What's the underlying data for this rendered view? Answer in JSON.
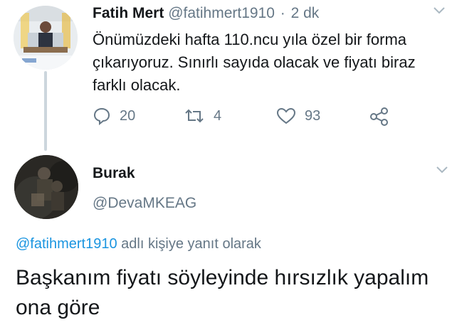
{
  "tweet1": {
    "name": "Fatih Mert",
    "handle": "@fatihmert1910",
    "separator": "·",
    "time": "2 dk",
    "text": "Önümüzdeki hafta 110.ncu yıla özel bir forma çıkarıyoruz. Sınırlı sayıda olacak ve fiyatı biraz farklı olacak.",
    "replies": "20",
    "retweets": "4",
    "likes": "93"
  },
  "tweet2": {
    "name": "Burak",
    "handle": "@DevaMKEAG",
    "reply_mention": "@fatihmert1910",
    "reply_suffix": " adlı kişiye yanıt olarak",
    "text": "Başkanım fiyatı söyleyinde hırsızlık yapalım ona göre"
  },
  "colors": {
    "text": "#14171a",
    "secondary": "#657786",
    "link": "#1b95e0",
    "thread_line": "#ccd6dd"
  },
  "icons": [
    "reply-icon",
    "retweet-icon",
    "like-icon",
    "share-icon",
    "chevron-down-icon"
  ]
}
